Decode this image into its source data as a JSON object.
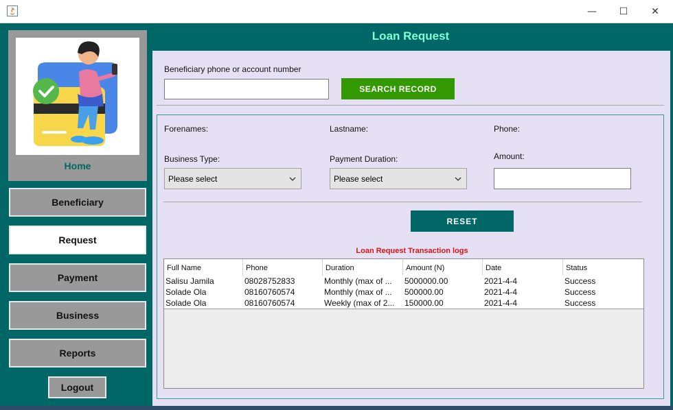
{
  "window": {
    "minimize_glyph": "—",
    "maximize_glyph": "☐",
    "close_glyph": "✕"
  },
  "sidebar": {
    "home_label": "Home",
    "items": [
      {
        "label": "Beneficiary"
      },
      {
        "label": "Request"
      },
      {
        "label": "Payment"
      },
      {
        "label": "Business"
      },
      {
        "label": "Reports"
      }
    ],
    "active_item": "Request",
    "logout_label": "Logout"
  },
  "main": {
    "title": "Loan Request",
    "search": {
      "label": "Beneficiary phone or account number",
      "value": "",
      "button_label": "SEARCH RECORD"
    },
    "form": {
      "forenames_label": "Forenames:",
      "lastname_label": "Lastname:",
      "phone_label": "Phone:",
      "business_type_label": "Business Type:",
      "business_type_value": "Please select",
      "payment_duration_label": "Payment Duration:",
      "payment_duration_value": "Please select",
      "amount_label": "Amount:",
      "amount_value": "",
      "reset_label": "RESET"
    },
    "logs": {
      "title": "Loan Request Transaction logs",
      "columns": [
        "Full Name",
        "Phone",
        "Duration",
        "Amount (N)",
        "Date",
        "Status"
      ],
      "rows": [
        [
          "Salisu Jamila",
          "08028752833",
          "Monthly (max of ...",
          "5000000.00",
          "2021-4-4",
          "Success"
        ],
        [
          "Solade Ola",
          "08160760574",
          "Monthly (max of ...",
          "500000.00",
          "2021-4-4",
          "Success"
        ],
        [
          "Solade Ola",
          "08160760574",
          "Weekly (max of 2...",
          "150000.00",
          "2021-4-4",
          "Success"
        ]
      ]
    }
  },
  "colors": {
    "teal": "#006666",
    "title_text": "#7fffd4",
    "panel_bg": "#e6e0f5",
    "search_button": "#339900",
    "logs_title": "#dd1111",
    "nav_bg": "#999999",
    "nav_active_bg": "#ffffff"
  }
}
